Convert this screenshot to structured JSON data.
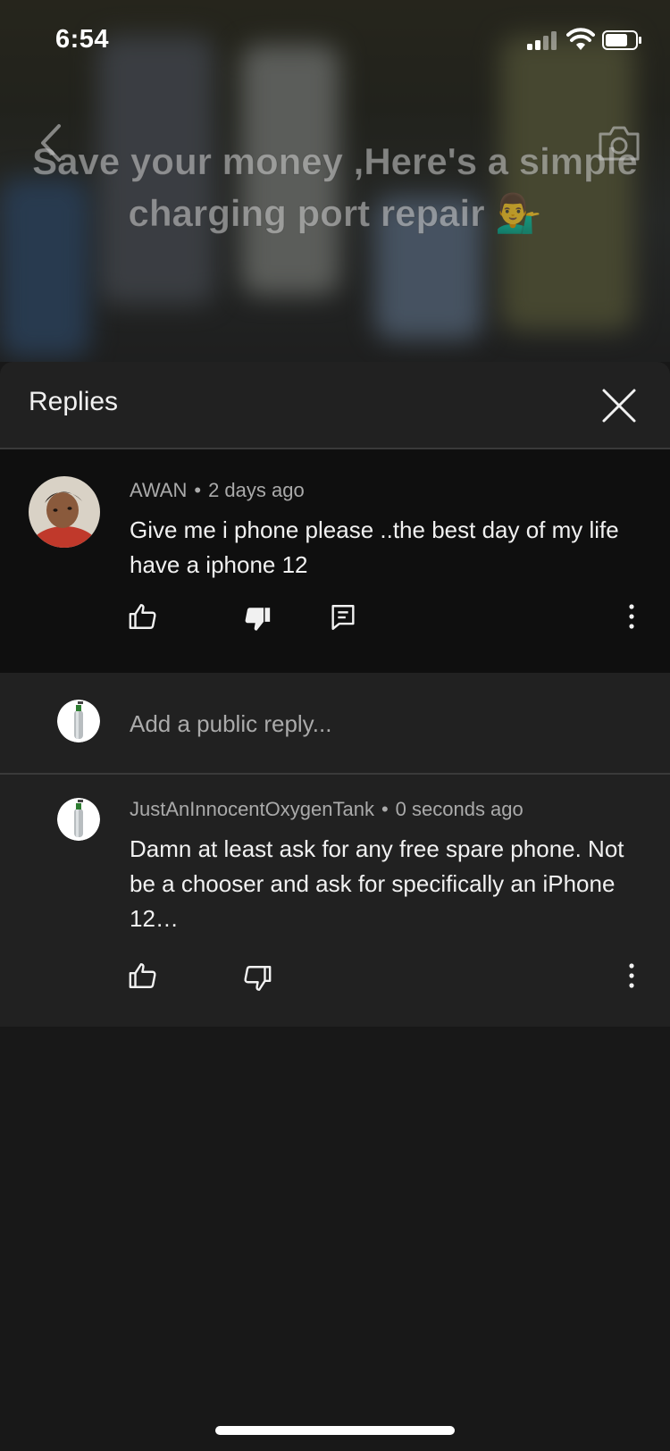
{
  "status_bar": {
    "time": "6:54",
    "signal_icon": "cellular-signal-icon",
    "wifi_icon": "wifi-icon",
    "battery_icon": "battery-icon",
    "battery_level": 0.7
  },
  "video": {
    "title_line1": "Save your money ,Here's a simple",
    "title_line2": "charging port repair 💁‍♂️",
    "back_icon": "chevron-left-icon",
    "camera_icon": "camera-icon"
  },
  "replies_panel": {
    "title": "Replies",
    "close_icon": "close-icon"
  },
  "parent_comment": {
    "author": "AWAN",
    "separator": "•",
    "time": "2 days ago",
    "text": "Give me i phone please ..the best day of my life have a iphone 12",
    "like_icon": "thumbs-up-icon",
    "dislike_icon": "thumbs-down-filled-icon",
    "reply_icon": "reply-icon",
    "more_icon": "more-vertical-icon"
  },
  "reply_input": {
    "placeholder": "Add a public reply..."
  },
  "reply": {
    "author": "JustAnInnocentOxygenTank",
    "separator": "•",
    "time": "0 seconds ago",
    "text": "Damn at least ask for any free spare phone. Not be a chooser and ask for specifically an iPhone 12…",
    "like_icon": "thumbs-up-icon",
    "dislike_icon": "thumbs-down-icon",
    "more_icon": "more-vertical-icon"
  }
}
